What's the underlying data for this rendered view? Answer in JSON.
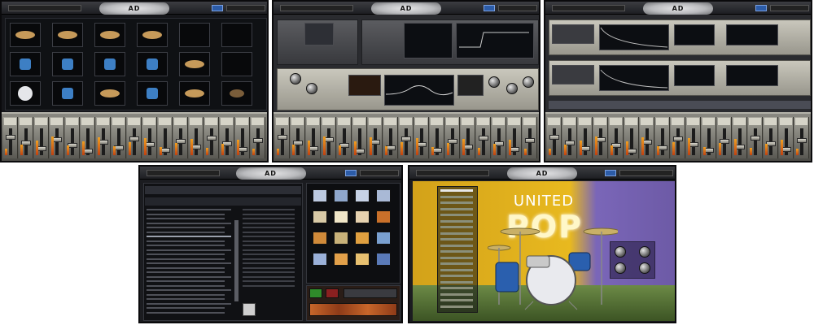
{
  "windows": [
    {
      "logo": "AD"
    },
    {
      "logo": "AD"
    },
    {
      "logo": "AD"
    },
    {
      "logo": "AD"
    },
    {
      "logo": "AD"
    }
  ],
  "poster": {
    "line1": "UNITED",
    "line2": "POP"
  },
  "colors": {
    "accent_blue": "#2c5ca8",
    "mixer_cream": "#c9c7bc",
    "meter_orange": "#e08a20",
    "room_yellow": "#e5b21c",
    "room_purple": "#7a66b8",
    "floor_green": "#5b7d3a"
  }
}
